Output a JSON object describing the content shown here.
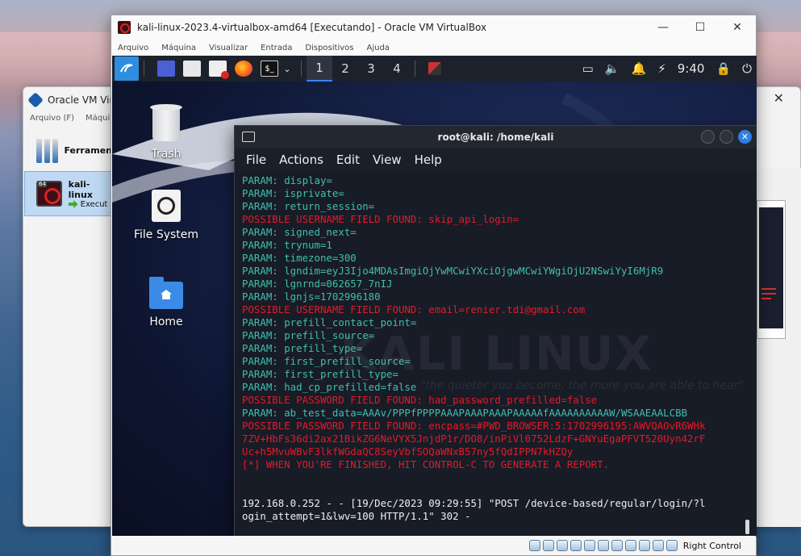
{
  "host": {
    "manager": {
      "title": "Oracle VM Virt",
      "menu": [
        "Arquivo (F)",
        "Máquin"
      ],
      "tools_label": "Ferramen",
      "vm_name": "kali-linux",
      "vm_state": "Execut"
    }
  },
  "vbox": {
    "title": "kali-linux-2023.4-virtualbox-amd64 [Executando] - Oracle VM VirtualBox",
    "menu": [
      "Arquivo",
      "Máquina",
      "Visualizar",
      "Entrada",
      "Dispositivos",
      "Ajuda"
    ],
    "status_label": "Right Control"
  },
  "kali": {
    "workspaces": [
      "1",
      "2",
      "3",
      "4"
    ],
    "clock": "9:40",
    "desktop_icons": {
      "trash": "Trash",
      "filesystem": "File System",
      "home": "Home"
    }
  },
  "terminal": {
    "title": "root@kali: /home/kali",
    "menu": [
      "File",
      "Actions",
      "Edit",
      "View",
      "Help"
    ],
    "watermark": "KALI LINUX",
    "watermark_sub": "\"the quieter you become, the more you are able to hear\"",
    "lines": [
      {
        "type": "param",
        "text": "PARAM: display="
      },
      {
        "type": "param",
        "text": "PARAM: isprivate="
      },
      {
        "type": "param",
        "text": "PARAM: return_session="
      },
      {
        "type": "found",
        "text": "POSSIBLE USERNAME FIELD FOUND: skip_api_login="
      },
      {
        "type": "param",
        "text": "PARAM: signed_next="
      },
      {
        "type": "param",
        "text": "PARAM: trynum=1"
      },
      {
        "type": "param",
        "text": "PARAM: timezone=300"
      },
      {
        "type": "param",
        "text": "PARAM: lgndim=eyJ3Ijo4MDAsImgiOjYwMCwiYXciOjgwMCwiYWgiOjU2NSwiYyI6MjR9"
      },
      {
        "type": "param",
        "text": "PARAM: lgnrnd=062657_7nIJ"
      },
      {
        "type": "param",
        "text": "PARAM: lgnjs=1702996180"
      },
      {
        "type": "found",
        "text": "POSSIBLE USERNAME FIELD FOUND: email=renier.tdi@gmail.com"
      },
      {
        "type": "param",
        "text": "PARAM: prefill_contact_point="
      },
      {
        "type": "param",
        "text": "PARAM: prefill_source="
      },
      {
        "type": "param",
        "text": "PARAM: prefill_type="
      },
      {
        "type": "param",
        "text": "PARAM: first_prefill_source="
      },
      {
        "type": "param",
        "text": "PARAM: first_prefill_type="
      },
      {
        "type": "param",
        "text": "PARAM: had_cp_prefilled=false"
      },
      {
        "type": "found",
        "text": "POSSIBLE PASSWORD FIELD FOUND: had_password_prefilled=false"
      },
      {
        "type": "param",
        "text": "PARAM: ab_test_data=AAAv/PPPfPPPPAAAPAAAPAAAPAAAAAfAAAAAAAAAAW/WSAAEAALCBB"
      },
      {
        "type": "found",
        "text": "POSSIBLE PASSWORD FIELD FOUND: encpass=#PWD_BROWSER:5:1702996195:AWVQAOvR6WHk"
      },
      {
        "type": "found",
        "text": "7ZV+HbFs36di2ax21BikZG6NeVYX5JnjdP1r/DO8/inPiVl0752LdzF+GNYuEgaPFVT520Uyn42rF"
      },
      {
        "type": "found",
        "text": "Uc+h5MvuWBvF3lkfWGdaQC8SeyVbfSOQaWNxB57ny5fQdIPPN7kHZQy"
      },
      {
        "type": "found",
        "text": "[*] WHEN YOU'RE FINISHED, HIT CONTROL-C TO GENERATE A REPORT."
      },
      {
        "type": "plain",
        "text": ""
      },
      {
        "type": "plain",
        "text": ""
      },
      {
        "type": "plain",
        "text": "192.168.0.252 - - [19/Dec/2023 09:29:55] \"POST /device-based/regular/login/?l"
      },
      {
        "type": "plain",
        "text": "ogin_attempt=1&lwv=100 HTTP/1.1\" 302 -"
      }
    ]
  },
  "colors": {
    "param": "#3fbfb0",
    "found": "#e5192a",
    "plain": "#f0f0f0",
    "accent": "#2f7fe6"
  }
}
